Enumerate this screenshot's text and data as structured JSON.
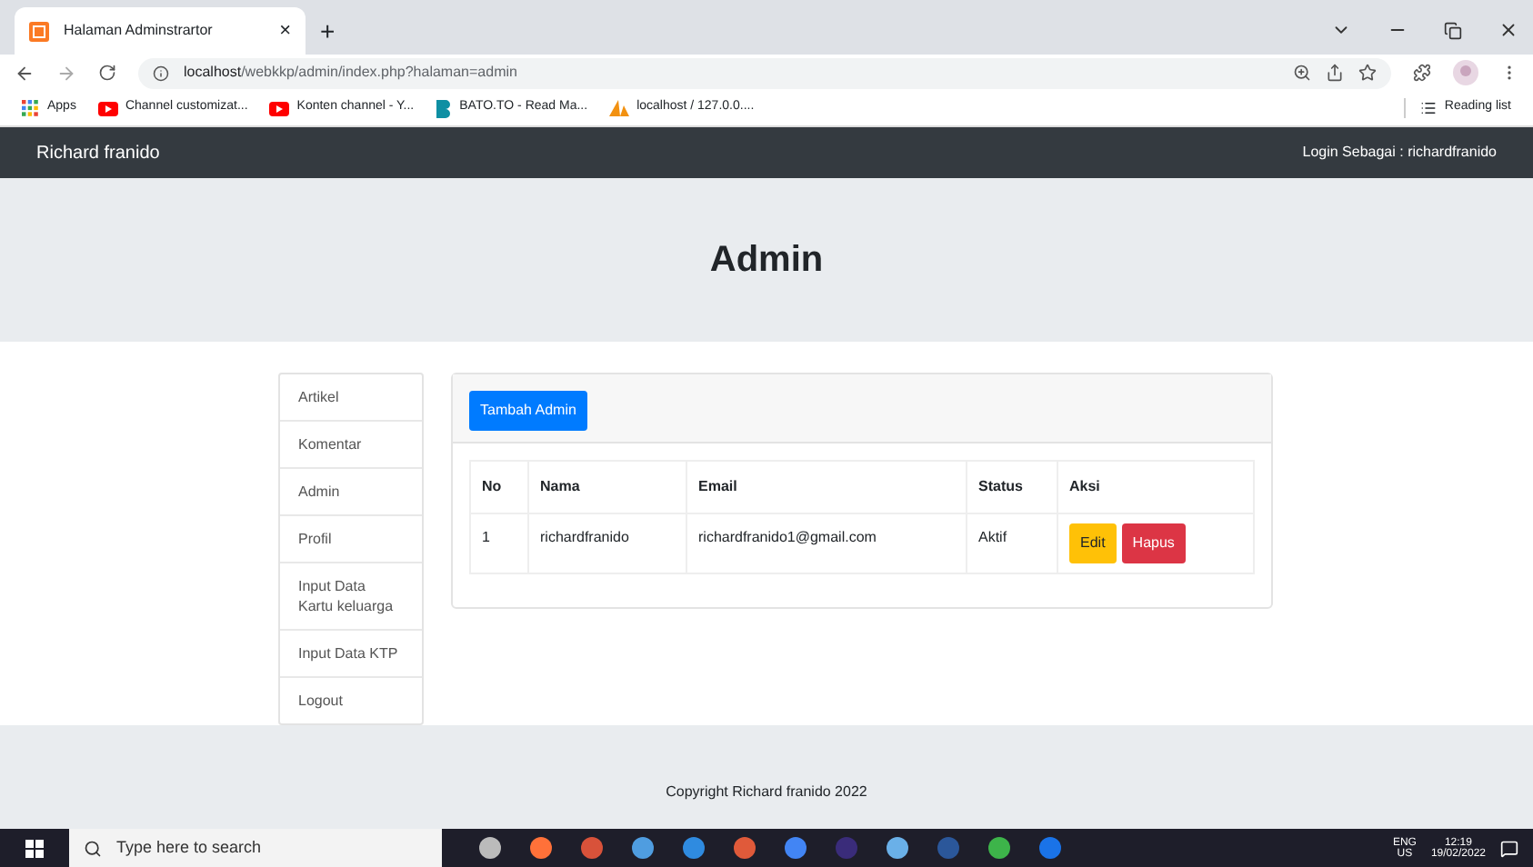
{
  "browser": {
    "tab_title": "Halaman Adminstrartor",
    "tab_close": "×",
    "new_tab": "+",
    "url_host": "localhost",
    "url_path": "/webkkp/admin/index.php?halaman=admin",
    "bookmarks": [
      {
        "label": "Apps",
        "kind": "apps"
      },
      {
        "label": "Channel customizat...",
        "kind": "youtube"
      },
      {
        "label": "Konten channel - Y...",
        "kind": "youtube"
      },
      {
        "label": "BATO.TO - Read Ma...",
        "kind": "bato"
      },
      {
        "label": "localhost / 127.0.0....",
        "kind": "pma"
      }
    ],
    "reading_list": "Reading list"
  },
  "navbar": {
    "brand": "Richard franido",
    "login": "Login Sebagai : richardfranido"
  },
  "jumbotron": {
    "title": "Admin"
  },
  "sidebar": {
    "items": [
      {
        "label": "Artikel"
      },
      {
        "label": "Komentar"
      },
      {
        "label": "Admin"
      },
      {
        "label": "Profil"
      },
      {
        "label": "Input Data Kartu keluarga"
      },
      {
        "label": "Input Data KTP"
      },
      {
        "label": "Logout"
      }
    ]
  },
  "panel": {
    "add_button": "Tambah Admin"
  },
  "table": {
    "columns": [
      "No",
      "Nama",
      "Email",
      "Status",
      "Aksi"
    ],
    "rows": [
      {
        "cells": [
          "1",
          "richardfranido",
          "richardfranido1@gmail.com",
          "Aktif"
        ],
        "actions": [
          {
            "label": "Edit",
            "kind": "warning"
          },
          {
            "label": "Hapus",
            "kind": "danger"
          }
        ]
      }
    ]
  },
  "footer": {
    "text": "Copyright Richard franido 2022"
  },
  "taskbar": {
    "search_placeholder": "Type here to search",
    "lang": "ENG",
    "region": "US",
    "time": "12:19",
    "date": "19/02/2022"
  }
}
